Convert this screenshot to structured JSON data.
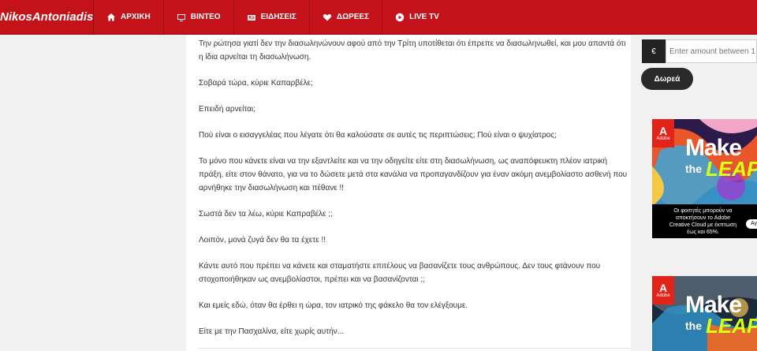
{
  "header": {
    "logo": "NikosAntoniadis.tv",
    "nav": [
      {
        "label": "ΑΡΧΙΚΗ",
        "icon": "home-icon"
      },
      {
        "label": "ΒΙΝΤΕΟ",
        "icon": "tv-icon"
      },
      {
        "label": "ΕΙΔΗΣΕΙΣ",
        "icon": "newspaper-icon"
      },
      {
        "label": "ΔΩΡΕΕΣ",
        "icon": "heart-icon"
      },
      {
        "label": "LIVE TV",
        "icon": "play-circle-icon"
      }
    ],
    "bg_color": "#c4121b"
  },
  "article": {
    "paragraphs": [
      "Την ρώτησα γιατί δεν την διασωληνώνουν αφού από την Τρίτη υποτίθεται ότι έπρεπε να διασωληνωθεί, και μου απαντά ότι η ίδια αρνείται τη διασωλήνωση.",
      "Σοβαρά τώρα, κύριε Καπαρβέλε;",
      "Επειδή αρνείται;",
      "Πού είναι ο εισαγγελέας που λέγατε ότι θα καλούσατε σε αυτές τις περιπτώσεις; Πού είναι ο ψυχίατρος;",
      "Το μόνο που κάνετε είναι να την εξαντλείτε και να την οδηγείτε είτε στη διασωλήνωση, ως αναπόφευκτη πλέον ιατρική πράξη, είτε στον θάνατο, για να το δώσετε μετά στα κανάλια να προπαγανδίζουν για έναν ακόμη ανεμβολίαστο ασθενή που αρνήθηκε την διασωλήνωση και πέθανε !!",
      "Σωστά δεν τα λέω, κύριε Καπραβέλε ;;",
      "Λοιπόν, μονά ζυγά δεν θα τα έχετε !!",
      "Κάντε αυτό που πρέπει να κάνετε και σταματήστε επιτέλους να βασανίζετε τους ανθρώπους. Δεν τους φτάνουν που στοχοποιήθηκαν ως ανεμβολίαστοι, πρέπει και να βασανίζονται ;;",
      "Και εμείς εδώ, όταν θα έρθει η ώρα, τον ιατρικό της φάκελο θα τον ελέγξουμε.",
      "Είτε με την Πασχαλίνα, είτε χωρίς αυτήν..."
    ]
  },
  "sidebar": {
    "currency": "€",
    "amount_placeholder": "Enter amount between 1",
    "donate_label": "Δωρεά"
  },
  "ads": [
    {
      "brand": "Adobe",
      "headline_1": "Make",
      "headline_2": "the",
      "headline_3": "LEAP",
      "caption_1": "Οι φοιτητές μπορούν να",
      "caption_2": "αποκτήσουν το Adobe",
      "caption_3": "Creative Cloud με έκπτωση",
      "caption_4": "έως και 65%.",
      "pill": "Αγ"
    },
    {
      "brand": "Adobe",
      "headline_1": "Make",
      "headline_2": "the",
      "headline_3": "LEAP"
    }
  ]
}
